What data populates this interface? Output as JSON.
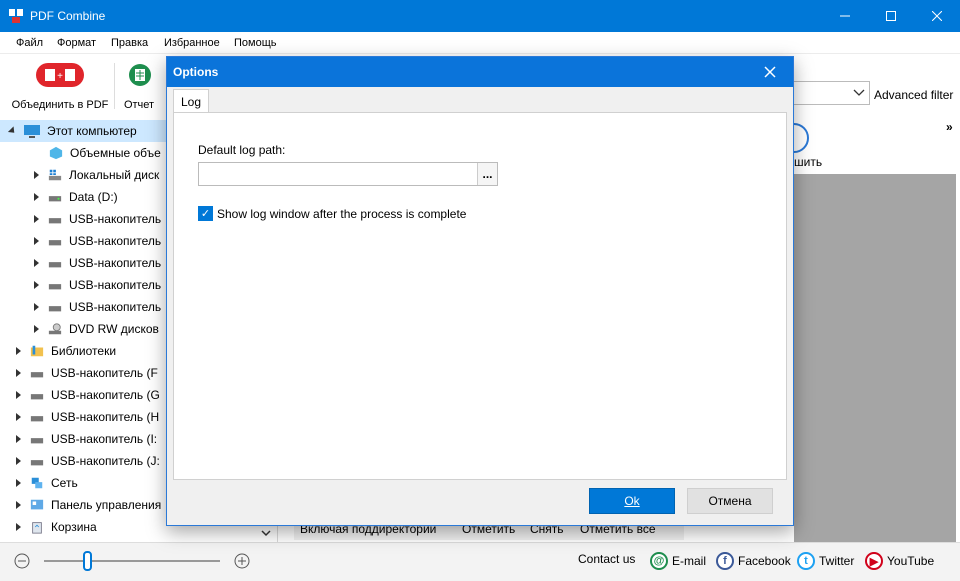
{
  "window": {
    "title": "PDF Combine",
    "minimize_icon": "minimize-icon",
    "maximize_icon": "maximize-icon",
    "close_icon": "close-icon",
    "accent": "#0078d7"
  },
  "menu": [
    "Файл",
    "Формат",
    "Правка",
    "Избранное",
    "Помощь"
  ],
  "toolbar": {
    "combine_label": "Объединить в PDF",
    "report_label": "Отчет",
    "filter_label": "Advanced filter",
    "partial_label": "шить"
  },
  "tree": {
    "root": "Этот компьютер",
    "children": [
      "Объемные объе",
      "Локальный диск",
      "Data (D:)",
      "USB-накопитель",
      "USB-накопитель",
      "USB-накопитель",
      "USB-накопитель",
      "USB-накопитель",
      "DVD RW дисков"
    ],
    "top": [
      "Библиотеки",
      "USB-накопитель (F",
      "USB-накопитель (G",
      "USB-накопитель (H",
      "USB-накопитель (I:",
      "USB-накопитель (J:",
      "Сеть",
      "Панель управления",
      "Корзина"
    ]
  },
  "bottom_strip": {
    "include_sub": "Включая поддиректории",
    "check": "Отметить",
    "uncheck": "Снять",
    "check_all": "Отметить все"
  },
  "status": {
    "contact": "Contact us",
    "email": "E-mail",
    "facebook": "Facebook",
    "twitter": "Twitter",
    "youtube": "YouTube"
  },
  "dialog": {
    "title": "Options",
    "tab": "Log",
    "path_label": "Default log path:",
    "path_value": "",
    "browse": "...",
    "checkbox_label": "Show log window after the process is complete",
    "checkbox_checked": true,
    "ok": "Ok",
    "cancel": "Отмена"
  }
}
